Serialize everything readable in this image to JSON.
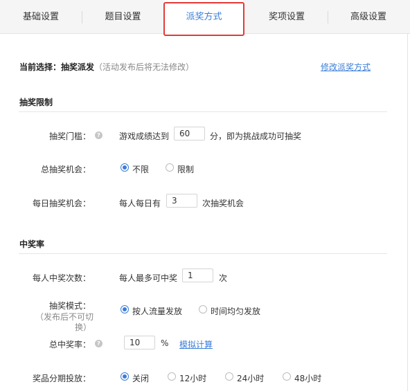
{
  "tabs": [
    "基础设置",
    "题目设置",
    "派奖方式",
    "奖项设置",
    "高级设置"
  ],
  "current": {
    "label": "当前选择：抽奖派发",
    "note": "（活动发布后将无法修改）",
    "modify_link": "修改派奖方式"
  },
  "limit_section": {
    "title": "抽奖限制",
    "threshold": {
      "label": "抽奖门槛：",
      "prefix": "游戏成绩达到",
      "value": "60",
      "suffix": "分，即为挑战成功可抽奖"
    },
    "total": {
      "label": "总抽奖机会：",
      "options": [
        "不限",
        "限制"
      ],
      "selected": "不限"
    },
    "daily": {
      "label": "每日抽奖机会：",
      "prefix": "每人每日有",
      "value": "3",
      "suffix": "次抽奖机会"
    }
  },
  "rate_section": {
    "title": "中奖率",
    "per_person": {
      "label": "每人中奖次数：",
      "prefix": "每人最多可中奖",
      "value": "1",
      "suffix": "次"
    },
    "mode": {
      "label": "抽奖模式：",
      "note_line1": "（发布后不可切",
      "note_line2": "换）",
      "options": [
        "按人流量发放",
        "时间均匀发放"
      ],
      "selected": "按人流量发放"
    },
    "total_rate": {
      "label": "总中奖率：",
      "value": "10",
      "unit": "%",
      "simulate_link": "模拟计算"
    },
    "staging": {
      "label": "奖品分期投放：",
      "options": [
        "关闭",
        "12小时",
        "24小时",
        "48小时"
      ],
      "selected": "关闭"
    }
  },
  "colors": {
    "accent": "#3b7dd8",
    "highlight_box": "#e53935"
  },
  "icons": {
    "help": "question-circle-icon"
  }
}
